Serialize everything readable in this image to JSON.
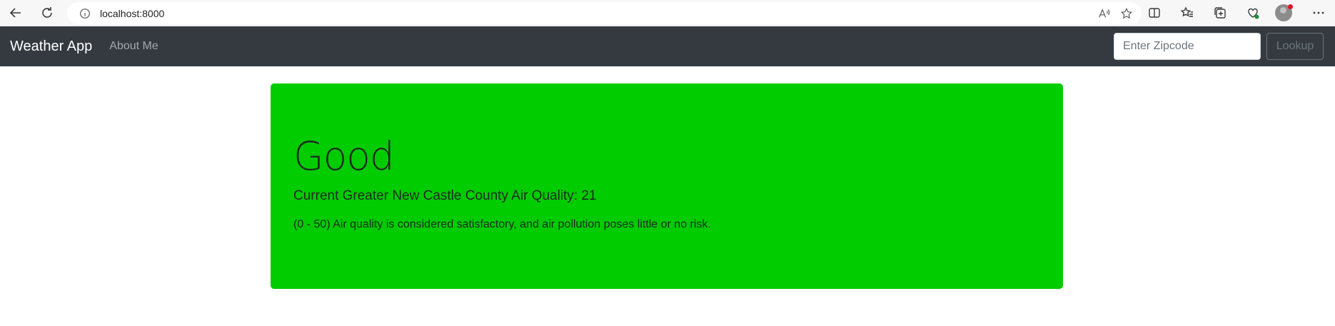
{
  "browser": {
    "url": "localhost:8000"
  },
  "navbar": {
    "brand": "Weather App",
    "about_link": "About Me",
    "zip_placeholder": "Enter Zipcode",
    "lookup_label": "Lookup"
  },
  "air_quality": {
    "category": "Good",
    "reading": "Current Greater New Castle County Air Quality: 21",
    "description": "(0 - 50) Air quality is considered satisfactory, and air pollution poses little or no risk.",
    "color": "#00cc00"
  },
  "icons": [
    "back-icon",
    "refresh-icon",
    "info-icon",
    "read-aloud-icon",
    "favorite-star-icon",
    "split-screen-icon",
    "favorites-icon",
    "collections-icon",
    "browser-essentials-icon",
    "profile-avatar",
    "more-icon"
  ]
}
